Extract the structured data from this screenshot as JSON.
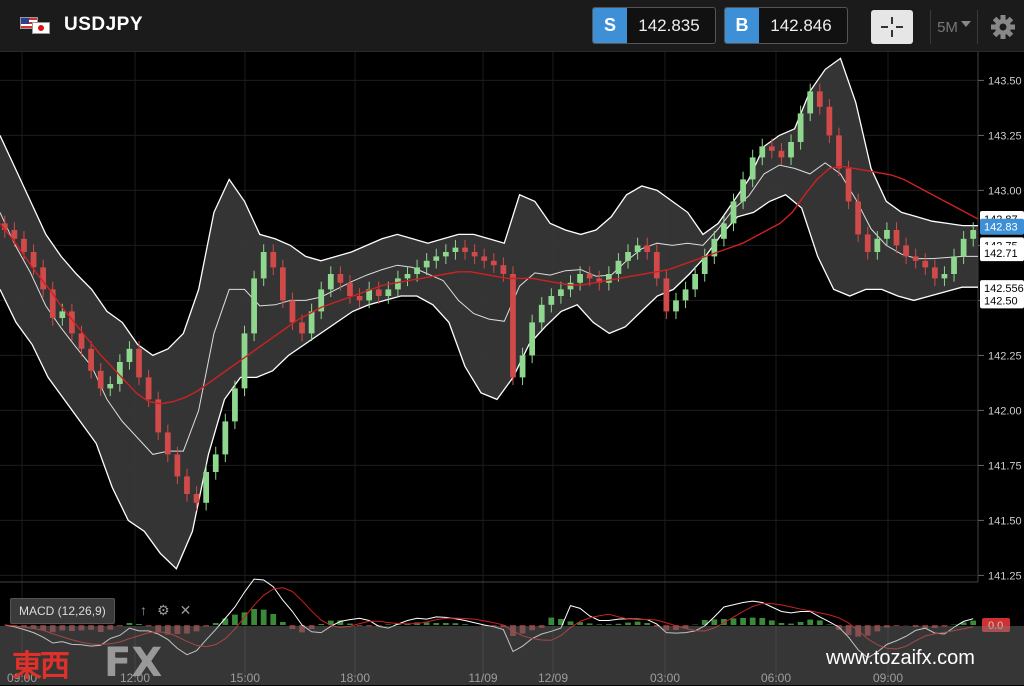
{
  "header": {
    "symbol": "USDJPY",
    "sell": {
      "tag": "S",
      "price": "142.835"
    },
    "buy": {
      "tag": "B",
      "price": "142.846"
    },
    "timeframe": "5M"
  },
  "colors": {
    "accent": "#3d8fd6",
    "bull": "#8fd68f",
    "bear": "#d04a4a",
    "ma": "#cc2222",
    "band": "#ffffff"
  },
  "chart_data": {
    "type": "candlestick",
    "y_ticks": [
      "143.50",
      "143.25",
      "143.00",
      "142.75",
      "142.50",
      "142.25",
      "142.00",
      "141.75",
      "141.50",
      "141.25"
    ],
    "y_tick_values": [
      143.5,
      143.25,
      143.0,
      142.75,
      142.5,
      142.25,
      142.0,
      141.75,
      141.5,
      141.25
    ],
    "ylim": [
      141.22,
      143.62
    ],
    "x_ticks": [
      "09:00",
      "12:00",
      "15:00",
      "18:00",
      "11/09",
      "12/09",
      "03:00",
      "06:00",
      "09:00"
    ],
    "price_tags": [
      {
        "label": "142.87",
        "value": 142.87
      },
      {
        "label": "142.83",
        "value": 142.835,
        "highlight": true
      },
      {
        "label": "142.75",
        "value": 142.75
      },
      {
        "label": "142.71",
        "value": 142.715
      },
      {
        "label": "142.556",
        "value": 142.556
      },
      {
        "label": "142.50",
        "value": 142.5
      }
    ],
    "close": [
      142.82,
      142.78,
      142.72,
      142.65,
      142.55,
      142.42,
      142.45,
      142.35,
      142.28,
      142.18,
      142.1,
      142.12,
      142.22,
      142.28,
      142.15,
      142.05,
      141.9,
      141.8,
      141.7,
      141.62,
      141.58,
      141.72,
      141.8,
      141.95,
      142.1,
      142.35,
      142.6,
      142.72,
      142.65,
      142.5,
      142.4,
      142.35,
      142.45,
      142.55,
      142.62,
      142.58,
      142.52,
      142.5,
      142.55,
      142.52,
      142.55,
      142.6,
      142.62,
      142.65,
      142.68,
      142.7,
      142.72,
      142.74,
      142.72,
      142.7,
      142.68,
      142.66,
      142.62,
      142.15,
      142.25,
      142.4,
      142.48,
      142.52,
      142.55,
      142.58,
      142.62,
      142.6,
      142.58,
      142.62,
      142.68,
      142.72,
      142.75,
      142.72,
      142.6,
      142.45,
      142.5,
      142.55,
      142.62,
      142.7,
      142.78,
      142.85,
      142.95,
      143.05,
      143.15,
      143.2,
      143.18,
      143.15,
      143.22,
      143.35,
      143.45,
      143.38,
      143.25,
      143.1,
      142.95,
      142.8,
      142.72,
      142.78,
      142.82,
      142.75,
      142.7,
      142.68,
      142.65,
      142.6,
      142.62,
      142.7,
      142.78,
      142.82
    ],
    "ma": [
      142.85,
      142.78,
      142.7,
      142.62,
      142.55,
      142.47,
      142.4,
      142.33,
      142.26,
      142.2,
      142.14,
      142.08,
      142.04,
      142.03,
      142.04,
      142.06,
      142.09,
      142.13,
      142.17,
      142.21,
      142.25,
      142.29,
      142.33,
      142.37,
      142.41,
      142.44,
      142.47,
      142.49,
      142.51,
      142.53,
      142.55,
      142.57,
      142.58,
      142.59,
      142.6,
      142.61,
      142.62,
      142.63,
      142.63,
      142.62,
      142.61,
      142.6,
      142.6,
      142.6,
      142.59,
      142.58,
      142.57,
      142.57,
      142.58,
      142.59,
      142.6,
      142.61,
      142.62,
      142.63,
      142.64,
      142.66,
      142.68,
      142.7,
      142.72,
      142.74,
      142.76,
      142.79,
      142.82,
      142.85,
      142.9,
      142.98,
      143.05,
      143.1,
      143.11,
      143.1,
      143.09,
      143.08,
      143.07,
      143.05,
      143.02,
      142.99,
      142.96,
      142.93,
      142.9,
      142.87
    ],
    "upper": [
      143.25,
      143.1,
      142.95,
      142.8,
      142.7,
      142.62,
      142.55,
      142.45,
      142.4,
      142.3,
      142.25,
      142.28,
      142.35,
      142.55,
      142.9,
      143.05,
      142.95,
      142.8,
      142.78,
      142.75,
      142.7,
      142.68,
      142.7,
      142.72,
      142.75,
      142.78,
      142.8,
      142.78,
      142.76,
      142.78,
      142.8,
      142.8,
      142.78,
      142.76,
      142.98,
      142.95,
      142.85,
      142.82,
      142.8,
      142.82,
      142.88,
      142.98,
      143.02,
      143.0,
      142.95,
      142.9,
      142.8,
      142.85,
      142.95,
      143.05,
      143.2,
      143.25,
      143.28,
      143.45,
      143.55,
      143.6,
      143.4,
      143.1,
      142.95,
      142.9,
      142.88,
      142.86,
      142.85,
      142.84,
      142.84
    ],
    "lower": [
      142.55,
      142.4,
      142.3,
      142.15,
      142.05,
      141.95,
      141.85,
      141.65,
      141.5,
      141.45,
      141.35,
      141.28,
      141.45,
      141.8,
      142.05,
      142.15,
      142.15,
      142.18,
      142.25,
      142.3,
      142.35,
      142.4,
      142.45,
      142.48,
      142.5,
      142.52,
      142.52,
      142.48,
      142.4,
      142.2,
      142.08,
      142.05,
      142.15,
      142.3,
      142.38,
      142.45,
      142.48,
      142.4,
      142.35,
      142.38,
      142.45,
      142.52,
      142.55,
      142.62,
      142.7,
      142.8,
      142.88,
      142.9,
      142.95,
      142.98,
      142.92,
      142.7,
      142.55,
      142.52,
      142.55,
      142.55,
      142.52,
      142.5,
      142.52,
      142.54,
      142.56,
      142.56
    ],
    "indicator": {
      "name": "MACD (12,26,9)",
      "tag": "0.0"
    }
  },
  "macd_tools": {
    "up": "↑",
    "settings": "⚙",
    "close": "✕"
  },
  "watermark": {
    "kanji": "東西",
    "fx": "FX",
    "url": "www.tozaifx.com"
  }
}
